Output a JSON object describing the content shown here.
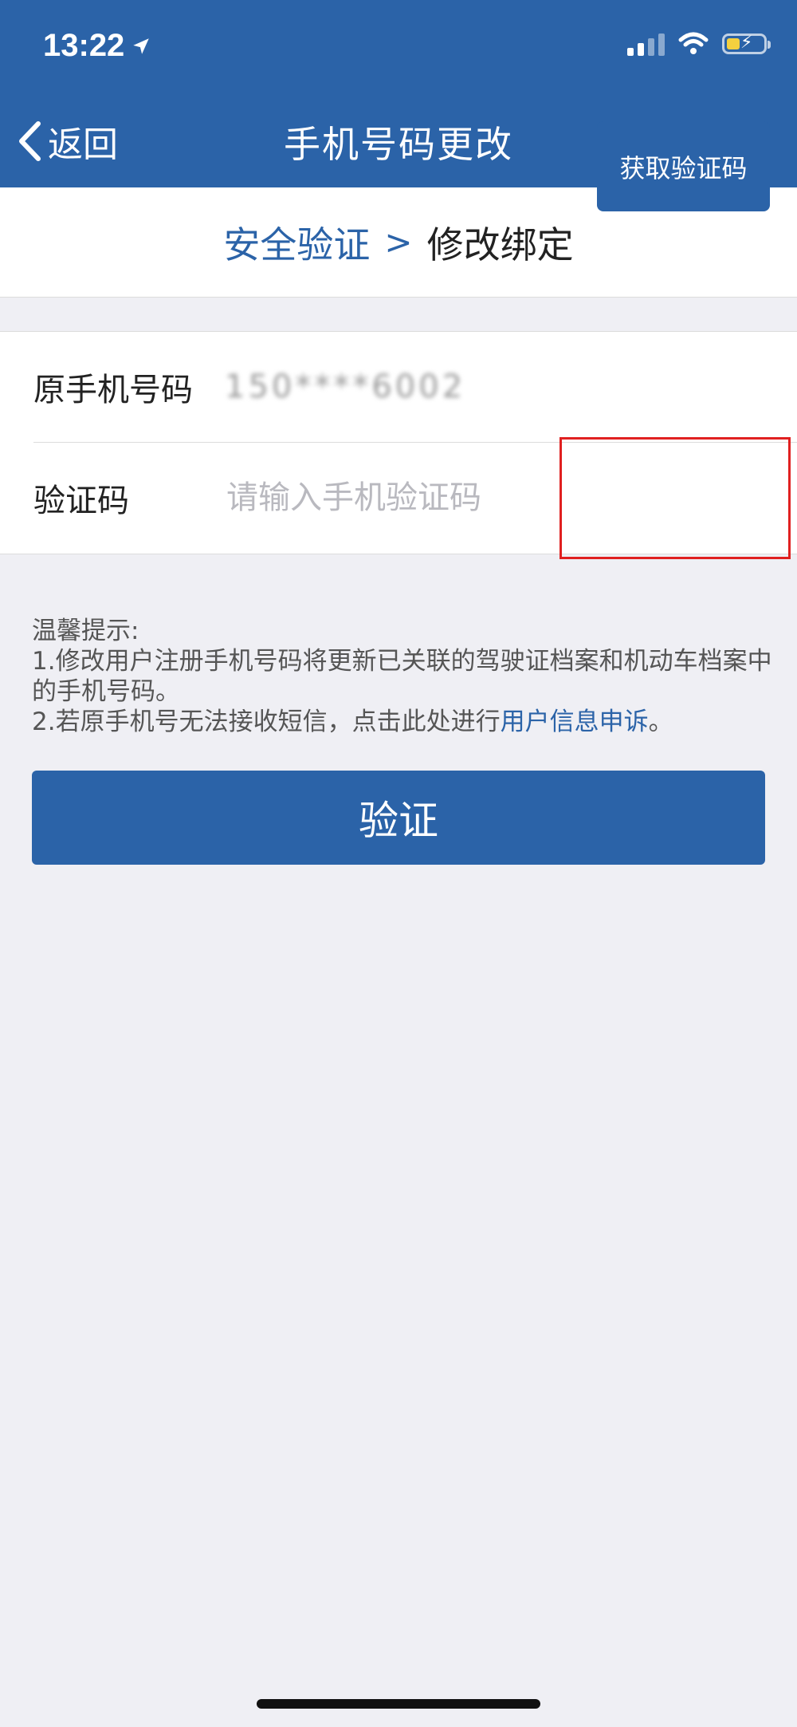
{
  "status": {
    "time": "13:22"
  },
  "nav": {
    "back_label": "返回",
    "title": "手机号码更改"
  },
  "steps": {
    "current": "安全验证",
    "separator": ">",
    "next": "修改绑定"
  },
  "form": {
    "phone_label": "原手机号码",
    "phone_value": "150****6002",
    "code_label": "验证码",
    "code_placeholder": "请输入手机验证码",
    "code_value": "",
    "get_code_label": "获取验证码"
  },
  "tips": {
    "title": "温馨提示:",
    "line1": "1.修改用户注册手机号码将更新已关联的驾驶证档案和机动车档案中的手机号码。",
    "line2_prefix": "2.若原手机号无法接收短信，点击此处进行",
    "line2_link": "用户信息申诉",
    "line2_suffix": "。"
  },
  "actions": {
    "verify_label": "验证"
  },
  "colors": {
    "primary": "#2b63a8",
    "background": "#efeff4",
    "highlight": "#e02020"
  }
}
